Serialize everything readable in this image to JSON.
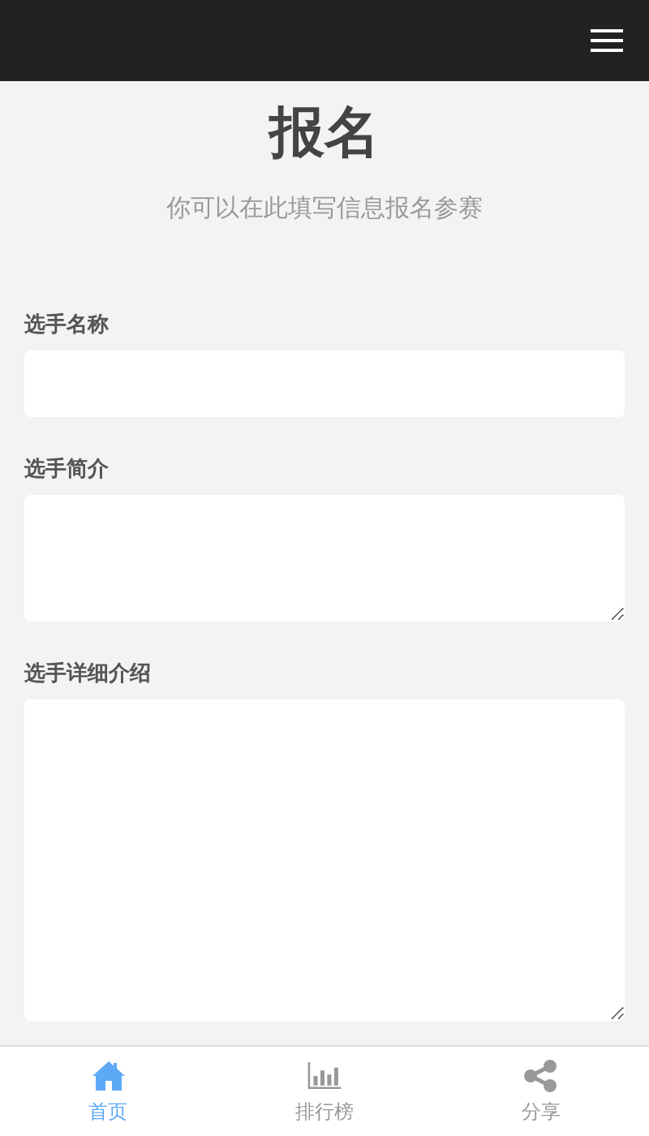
{
  "title": "报名",
  "subtitle": "你可以在此填写信息报名参赛",
  "fields": [
    {
      "label": "选手名称",
      "kind": "input"
    },
    {
      "label": "选手简介",
      "kind": "short"
    },
    {
      "label": "选手详细介绍",
      "kind": "long"
    }
  ],
  "nav": [
    {
      "label": "首页",
      "kind": "home",
      "selected": true
    },
    {
      "label": "排行榜",
      "kind": "chart",
      "selected": false
    },
    {
      "label": "分享",
      "kind": "share",
      "selected": false
    }
  ]
}
